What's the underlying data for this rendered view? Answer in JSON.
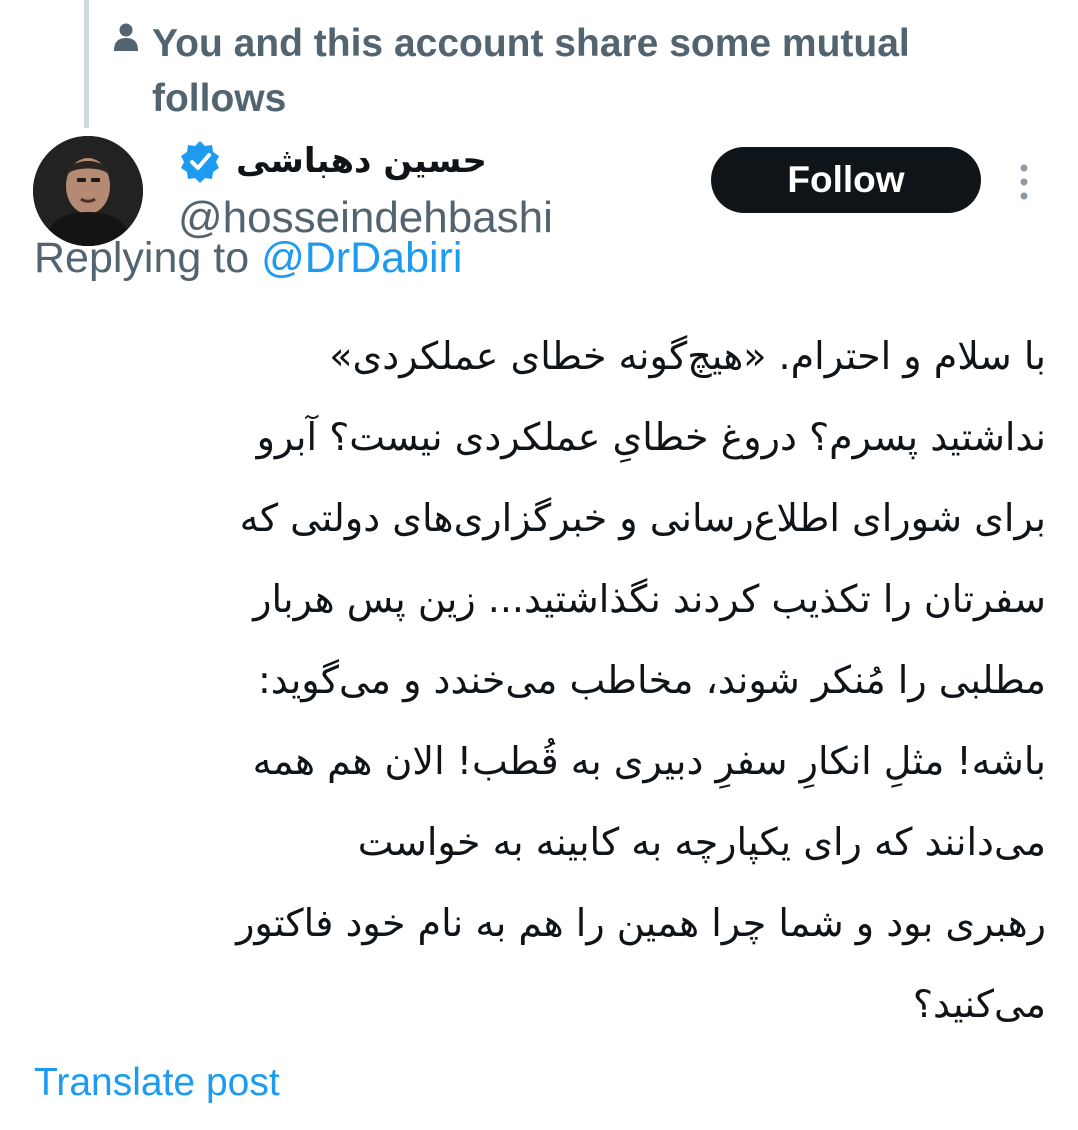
{
  "context": {
    "mutual_text": "You and this account share some mutual follows"
  },
  "author": {
    "display_name": "حسین دهباشی",
    "handle": "@hosseindehbashi",
    "verified": true
  },
  "actions": {
    "follow_label": "Follow"
  },
  "reply": {
    "prefix": "Replying to ",
    "mention": "@DrDabiri"
  },
  "post": {
    "lines": [
      "با سلام و احترام. «هیچ‌گونه خطای عملکردی»",
      "نداشتید پسرم؟ دروغ خطایِ عملکردی نیست؟ آبرو",
      "برای شورای اطلاع‌رسانی و خبرگزاری‌های دولتی که",
      "سفرتان را تکذیب کردند نگذاشتید... زین پس هربار",
      "مطلبی را مُنکر شوند، مخاطب می‌خندد و می‌گوید:",
      "باشه! مثلِ انکارِ سفرِ دبیری به قُطب! الان هم همه",
      "می‌دانند که رای یکپارچه به کابینه به خواست",
      "رهبری بود و شما چرا همین را هم به نام خود فاکتور",
      "می‌کنید؟"
    ]
  },
  "footer": {
    "translate_label": "Translate post"
  },
  "colors": {
    "accent": "#1d9bf0",
    "secondary_text": "#536471",
    "primary_text": "#0f1419",
    "thread_line": "#cfd9de"
  },
  "icons": {
    "mutual": "person-icon",
    "verified": "verified-badge-icon",
    "more": "more-vertical-icon"
  }
}
